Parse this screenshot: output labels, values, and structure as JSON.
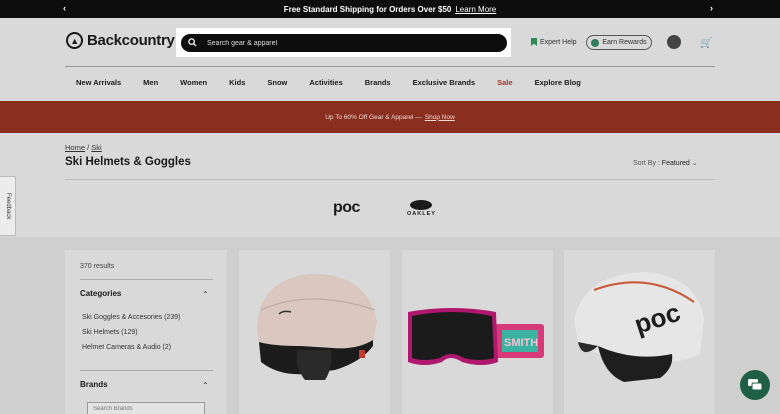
{
  "promo": {
    "text": "Free Standard Shipping for Orders Over $50",
    "link": "Learn More",
    "prev_arrow": "‹",
    "next_arrow": "›"
  },
  "header": {
    "logo_text": "Backcountry",
    "search_placeholder": "Search gear & apparel",
    "expert_help": "Expert Help",
    "earn_rewards": "Earn Rewards",
    "cart_icon": "🛒"
  },
  "nav": {
    "items": [
      "New Arrivals",
      "Men",
      "Women",
      "Kids",
      "Snow",
      "Activities",
      "Brands",
      "Exclusive Brands",
      "Sale",
      "Explore Blog"
    ]
  },
  "banner": {
    "text": "Up To 60% Off Gear & Apparel —",
    "link": "Shop Now"
  },
  "breadcrumb": {
    "home": "Home",
    "separator": "/",
    "ski": "Ski"
  },
  "page": {
    "title": "Ski Helmets & Goggles",
    "sort_label": "Sort By :",
    "sort_value": "Featured",
    "sort_chevron": "⌄"
  },
  "feedback": "Feedback",
  "brands": {
    "poc": "poc",
    "oakley": "OAKLEY"
  },
  "sidebar": {
    "results": "370 results",
    "categories_heading": "Categories",
    "categories": [
      "Ski Goggles & Accesories (239)",
      "Ski Helmets (129)",
      "Helmet Cameras & Audio (2)"
    ],
    "brands_heading": "Brands",
    "brands_search_placeholder": "Search Brands",
    "chevron": "⌃"
  },
  "products": {
    "goggle_strap_text": "SMITH",
    "helmet_brand_text": "poc"
  },
  "colors": {
    "accent_banner": "#8a2f1f",
    "sale_text": "#a0352b",
    "chat_button": "#1f5f45"
  }
}
